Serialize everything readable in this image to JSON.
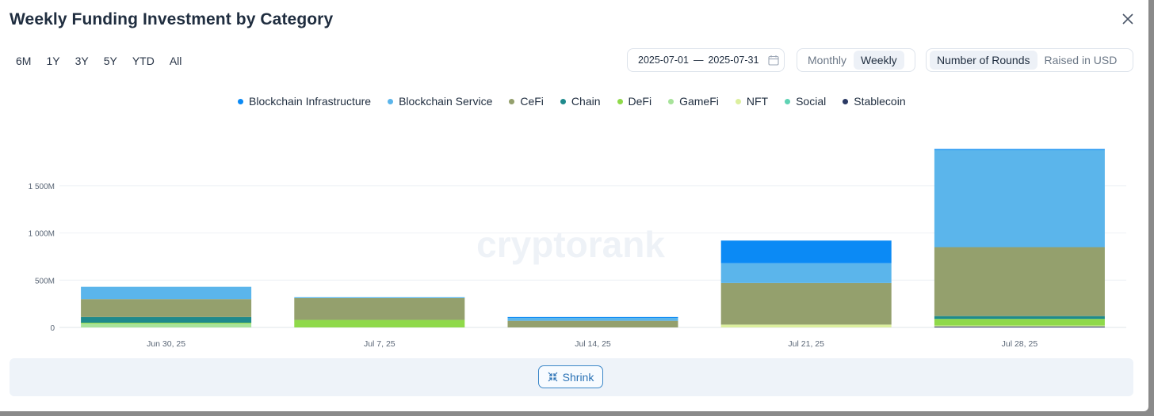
{
  "header": {
    "title": "Weekly Funding Investment by Category"
  },
  "ranges": [
    "6M",
    "1Y",
    "3Y",
    "5Y",
    "YTD",
    "All"
  ],
  "date_range": {
    "start": "2025-07-01",
    "separator": "—",
    "end": "2025-07-31"
  },
  "period_toggle": {
    "options": [
      "Monthly",
      "Weekly"
    ],
    "selected": "Weekly"
  },
  "metric_toggle": {
    "options": [
      "Number of Rounds",
      "Raised in USD"
    ],
    "selected": "Number of Rounds"
  },
  "watermark": "cryptorank",
  "footer": {
    "shrink_label": "Shrink"
  },
  "icons": {
    "close": "close-icon",
    "calendar": "calendar-icon",
    "shrink": "collapse-arrows-icon"
  },
  "chart_data": {
    "type": "bar",
    "stacked": true,
    "categories": [
      "Jun 30, 25",
      "Jul 7, 25",
      "Jul 14, 25",
      "Jul 21, 25",
      "Jul 28, 25"
    ],
    "y_ticks": [
      {
        "value": 0,
        "label": "0"
      },
      {
        "value": 500,
        "label": "500M"
      },
      {
        "value": 1000,
        "label": "1 000M"
      },
      {
        "value": 1500,
        "label": "1 500M"
      }
    ],
    "ylim": [
      0,
      1900
    ],
    "unit": "M",
    "grid": true,
    "legend_position": "top-center",
    "series": [
      {
        "name": "Stablecoin",
        "color": "#2b3a64",
        "values": [
          0,
          0,
          0,
          0,
          10
        ]
      },
      {
        "name": "NFT",
        "color": "#dcef9e",
        "values": [
          0,
          0,
          0,
          30,
          10
        ]
      },
      {
        "name": "GameFi",
        "color": "#a7e39a",
        "values": [
          40,
          0,
          0,
          0,
          0
        ]
      },
      {
        "name": "DeFi",
        "color": "#8fd94a",
        "values": [
          10,
          80,
          0,
          0,
          70
        ]
      },
      {
        "name": "Chain",
        "color": "#1f8a8c",
        "values": [
          60,
          0,
          0,
          0,
          30
        ]
      },
      {
        "name": "CeFi",
        "color": "#94a06d",
        "values": [
          190,
          230,
          70,
          440,
          730
        ]
      },
      {
        "name": "Social",
        "color": "#5fd3b4",
        "values": [
          0,
          0,
          0,
          0,
          0
        ]
      },
      {
        "name": "Blockchain Service",
        "color": "#5bb5eb",
        "values": [
          130,
          10,
          30,
          210,
          1030
        ]
      },
      {
        "name": "Blockchain Infrastructure",
        "color": "#0b8af5",
        "values": [
          0,
          0,
          10,
          240,
          10
        ]
      }
    ],
    "legend_order": [
      "Blockchain Infrastructure",
      "Blockchain Service",
      "CeFi",
      "Chain",
      "DeFi",
      "GameFi",
      "NFT",
      "Social",
      "Stablecoin"
    ]
  }
}
